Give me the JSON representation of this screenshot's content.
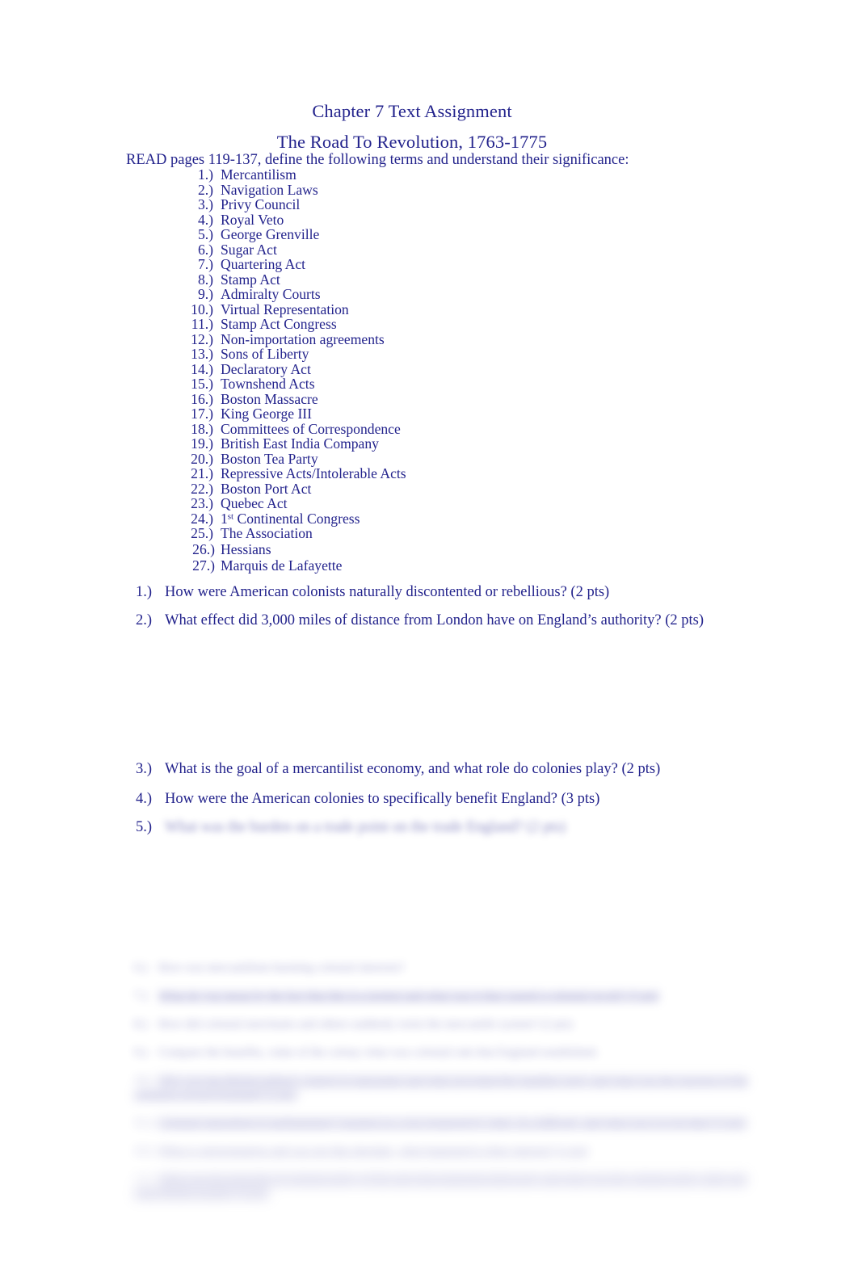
{
  "document": {
    "title_main": "Chapter 7 Text Assignment",
    "title_sub": "The Road To Revolution, 1763-1775",
    "read_instruction": "READ pages 119-137, define the following terms and understand their significance:",
    "text_color": "#23238c",
    "background_color": "#ffffff"
  },
  "terms": [
    {
      "num": "1.)",
      "label": "Mercantilism"
    },
    {
      "num": "2.)",
      "label": "Navigation Laws"
    },
    {
      "num": "3.)",
      "label": "Privy Council"
    },
    {
      "num": "4.)",
      "label": "Royal Veto"
    },
    {
      "num": "5.)",
      "label": "George Grenville"
    },
    {
      "num": "6.)",
      "label": "Sugar Act"
    },
    {
      "num": "7.)",
      "label": "Quartering Act"
    },
    {
      "num": "8.)",
      "label": "Stamp Act"
    },
    {
      "num": "9.)",
      "label": "Admiralty Courts"
    },
    {
      "num": "10.)",
      "label": "Virtual Representation"
    },
    {
      "num": "11.)",
      "label": "Stamp Act Congress"
    },
    {
      "num": "12.)",
      "label": "Non-importation agreements"
    },
    {
      "num": "13.)",
      "label": "Sons of Liberty"
    },
    {
      "num": "14.)",
      "label": "Declaratory Act"
    },
    {
      "num": "15.)",
      "label": "Townshend Acts"
    },
    {
      "num": "16.)",
      "label": "Boston Massacre"
    },
    {
      "num": "17.)",
      "label": "King George III"
    },
    {
      "num": "18.)",
      "label": "Committees of Correspondence"
    },
    {
      "num": "19.)",
      "label": "British East India Company"
    },
    {
      "num": "20.)",
      "label": "Boston Tea Party"
    },
    {
      "num": "21.)",
      "label": "Repressive Acts/Intolerable Acts"
    },
    {
      "num": "22.)",
      "label": "Boston Port Act"
    },
    {
      "num": "23.)",
      "label": "Quebec Act"
    },
    {
      "num": "24.)",
      "label_prefix": "1",
      "label_sup": "st",
      "label_suffix": " Continental Congress"
    },
    {
      "num": "25.)",
      "label": "The Association"
    },
    {
      "num": "26.)",
      "label": "Hessians"
    },
    {
      "num": "27.)",
      "label": "Marquis de Lafayette"
    }
  ],
  "questions": [
    {
      "num": "1.)",
      "text": "How were American colonists naturally discontented or rebellious? (2 pts)",
      "legible": true
    },
    {
      "num": "2.)",
      "text": "What effect did 3,000 miles of distance from London have on England’s authority? (2 pts)",
      "legible": true
    },
    {
      "num": "3.)",
      "text": "What is the goal of a mercantilist economy, and what role do colonies play? (2 pts)",
      "legible": true
    },
    {
      "num": "4.)",
      "text": "How were the American colonies to specifically benefit England? (3 pts)",
      "legible": true
    },
    {
      "num": "5.)",
      "text": "What was the burden on a trade point on the trade England? (2 pts)",
      "legible": false
    }
  ],
  "obscured_section": {
    "note": "lower portion of page is blurred and illegible",
    "lines": [
      {
        "num": "6.)",
        "text": "How was mercantilism harming colonial interests?"
      },
      {
        "num": "7.)",
        "text": "What do you mean by the fact that this is a protest and what was it that caused a colonial revolt? (3 pts)"
      },
      {
        "num": "8.)",
        "text": "How did colonial merchants and others suddenly resist the mercantile system? (2 pts)"
      },
      {
        "num": "9.)",
        "text": "Compare the benefits, value of the colony what was colonial rule that England established."
      },
      {
        "num": "10.)",
        "text": "Why was the British military control so unpopular and what provoked the standing army and what was the reaction of the colonists toward England? (3 pts)"
      },
      {
        "num": "11.)",
        "text": "Colonial opposition to parliamentary taxation as a was triggered by what, in a difficult, and what was it to be that? (3 pts)"
      },
      {
        "num": "12.)",
        "text": "What is representation and was not that absolute, what happened to their interest? (2 pts)"
      },
      {
        "num": "13.)",
        "text": "What was the principle of colonial policy of the and what happened afterward, and what was the colonial policy after and what British people? (4 pts)"
      }
    ]
  }
}
